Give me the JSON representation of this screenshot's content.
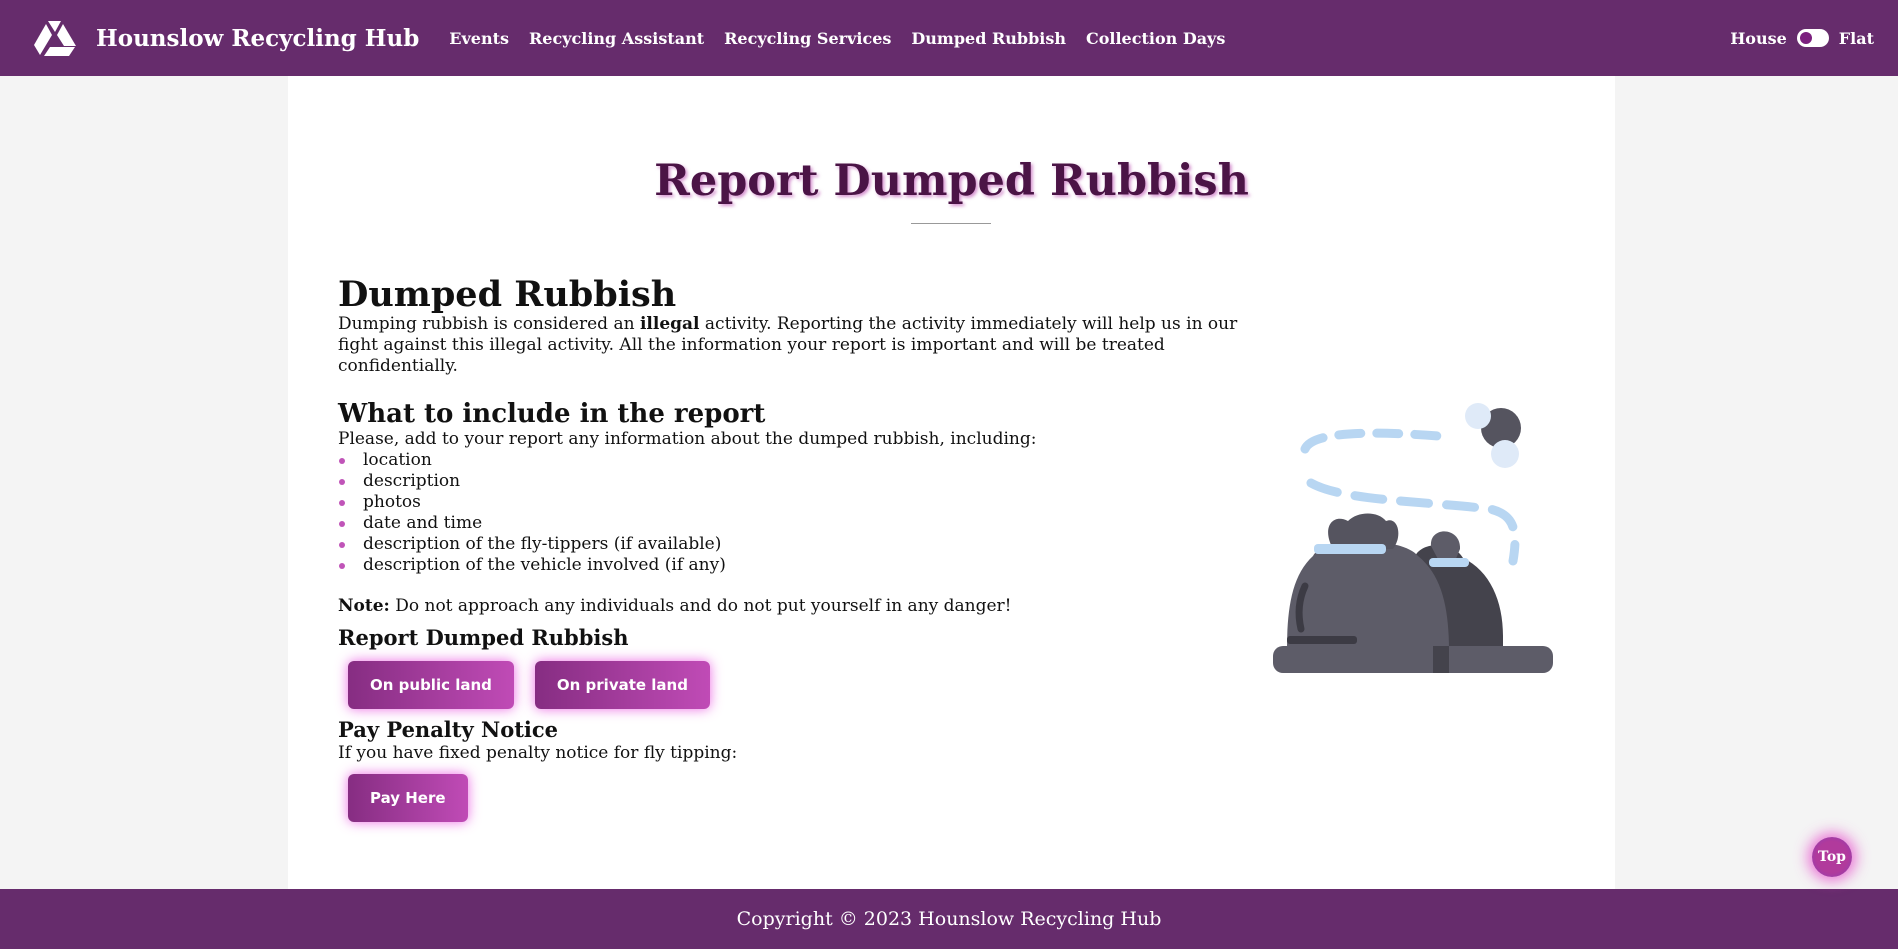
{
  "header": {
    "brand": "Hounslow Recycling Hub",
    "logo_icon": "recycle-triangle-icon",
    "nav": [
      "Events",
      "Recycling Assistant",
      "Recycling Services",
      "Dumped Rubbish",
      "Collection Days"
    ],
    "switch": {
      "left_label": "House",
      "right_label": "Flat"
    },
    "color": "#662c6c"
  },
  "page": {
    "title": "Report Dumped Rubbish",
    "section1": {
      "heading": "Dumped Rubbish",
      "text_before": "Dumping rubbish is considered an ",
      "text_bold": "illegal",
      "text_after": " activity. Reporting the activity immediately will help us in our fight against this illegal activity. All the information your report is important and will be treated confidentially."
    },
    "section2": {
      "heading": "What to include in the report",
      "intro": "Please, add to your report any information about the dumped rubbish, including:",
      "items": [
        "location",
        "description",
        "photos",
        "date and time",
        "description of the fly-tippers (if available)",
        "description of the vehicle involved (if any)"
      ]
    },
    "note": {
      "label": "Note:",
      "text": " Do not approach any individuals and do not put yourself in any danger!"
    },
    "report": {
      "heading": "Report Dumped Rubbish",
      "buttons": [
        "On public land",
        "On private land"
      ]
    },
    "penalty": {
      "heading": "Pay Penalty Notice",
      "text": "If you have fixed penalty notice for fly tipping:",
      "button": "Pay Here"
    },
    "illustration": "garbage-bags-icon"
  },
  "footer": {
    "text": "Copyright © 2023 Hounslow Recycling Hub"
  },
  "top_button": {
    "label": "Top"
  }
}
